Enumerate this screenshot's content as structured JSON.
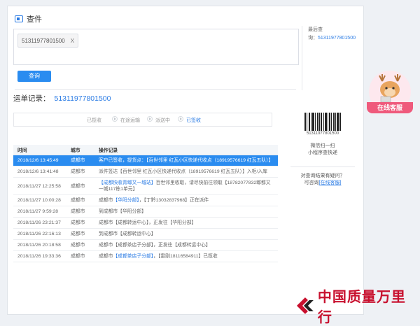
{
  "header": {
    "title": "查件"
  },
  "search": {
    "tag_value": "51311977801500",
    "tag_close": "X",
    "query_button": "查询"
  },
  "recent": {
    "label": "最后查",
    "label2": "询：",
    "number": "51311977801500"
  },
  "waybill": {
    "label": "运单记录：",
    "number": "51311977801500"
  },
  "steps": [
    {
      "label": "已揽收",
      "active": false
    },
    {
      "label": "在途运输",
      "active": false
    },
    {
      "label": "派送中",
      "active": false
    },
    {
      "label": "已签收",
      "active": true
    }
  ],
  "side": {
    "barcode_number": "51311977801500",
    "scan_line1": "微信扫一扫",
    "scan_line2": "小程序查快递",
    "question": "对查询结果有疑问？",
    "question_prefix": "可咨询",
    "question_link": "[在线客服]"
  },
  "table": {
    "headers": [
      "时间",
      "城市",
      "操作记录"
    ],
    "rows": [
      {
        "time": "2018/12/6 13:45:49",
        "city": "成都市",
        "record": "客户已签收，提货点：【百世邻里 红瓦小区快递代收点（18919576619 红瓦五队）】",
        "active": true
      },
      {
        "time": "2018/12/6 13:41:48",
        "city": "成都市",
        "record": "派件签达【百世邻里 红瓦小区快递代收点（18919576619 红瓦五队）】入柜/入库",
        "active": false
      },
      {
        "time": "2018/11/27 12:25:58",
        "city": "成都市",
        "record_pre": "",
        "record_link": "【成都快收青郫又一城站】",
        "record_post": "百世邻里收取，请尽快前往领取【18782077832郫都又一城117栋1单元】",
        "record": "",
        "active": false
      },
      {
        "time": "2018/11/27 10:00:28",
        "city": "成都市",
        "record_pre": "成都市",
        "record_link": "【华阳分部】",
        "record_post": "，【丁黔13032837968】正在派件",
        "record": "",
        "active": false
      },
      {
        "time": "2018/11/27 9:59:28",
        "city": "成都市",
        "record": "到成都市【华阳分部】",
        "active": false
      },
      {
        "time": "2018/11/26 23:21:37",
        "city": "成都市",
        "record": "成都市【成都转运中心】，正发往【华阳分部】",
        "active": false
      },
      {
        "time": "2018/11/26 22:16:13",
        "city": "成都市",
        "record": "到成都市【成都转运中心】",
        "active": false
      },
      {
        "time": "2018/11/26 20:18:58",
        "city": "成都市",
        "record": "成都市【成都茶店子分部】，正发往【成都转运中心】",
        "active": false
      },
      {
        "time": "2018/11/26 19:33:36",
        "city": "成都市",
        "record_pre": "成都市",
        "record_link": "【成都茶店子分部】",
        "record_post": "，【雷刚18116584911】已揽收",
        "record": "",
        "active": false
      }
    ]
  },
  "kefu": {
    "label": "在线客服"
  },
  "watermark": {
    "text": "中国质量万里行"
  },
  "colors": {
    "accent": "#2a8cf0",
    "link": "#2a7be4",
    "kefu": "#ef5a7c",
    "watermark": "#c8102e"
  }
}
